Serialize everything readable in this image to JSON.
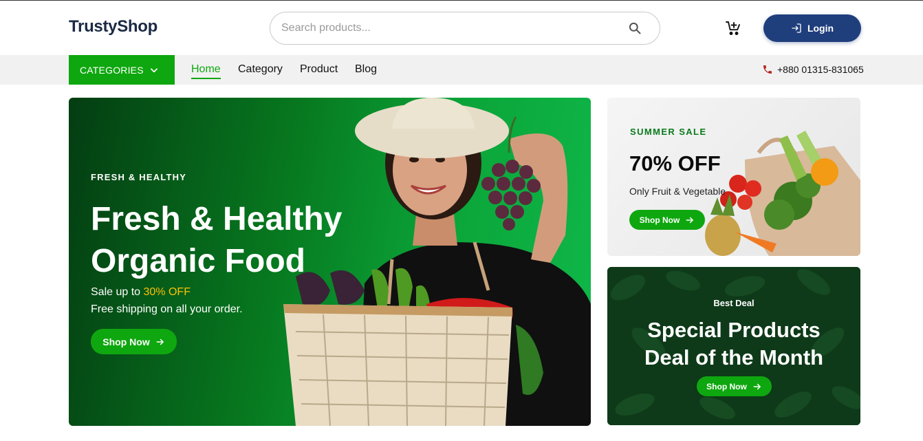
{
  "header": {
    "logo": "TrustyShop",
    "search_placeholder": "Search products...",
    "login_label": "Login"
  },
  "nav": {
    "categories_label": "CATEGORIES",
    "links": [
      "Home",
      "Category",
      "Product",
      "Blog"
    ],
    "active": "Home",
    "phone": "+880 01315-831065"
  },
  "hero": {
    "eyebrow": "FRESH & HEALTHY",
    "title": "Fresh & Healthy Organic Food",
    "sale_prefix": "Sale up to ",
    "sale_highlight": "30% OFF",
    "shipping": "Free shipping on all your order.",
    "button": "Shop Now"
  },
  "promo_summer": {
    "eyebrow": "SUMMER SALE",
    "title": "70% OFF",
    "subtitle": "Only Fruit & Vegetable",
    "button": "Shop Now"
  },
  "promo_deal": {
    "eyebrow": "Best Deal",
    "title_line1": "Special Products",
    "title_line2": "Deal of the Month",
    "button": "Shop Now"
  },
  "colors": {
    "brand_green": "#0fa70f",
    "login_blue": "#1f3e7c",
    "highlight_yellow": "#ffc107",
    "logo_navy": "#1b2a44"
  },
  "icons": {
    "search": "search-icon",
    "cart": "cart-add-icon",
    "login": "login-icon",
    "chevron": "chevron-down-icon",
    "phone": "phone-icon",
    "arrow": "arrow-right-icon"
  }
}
